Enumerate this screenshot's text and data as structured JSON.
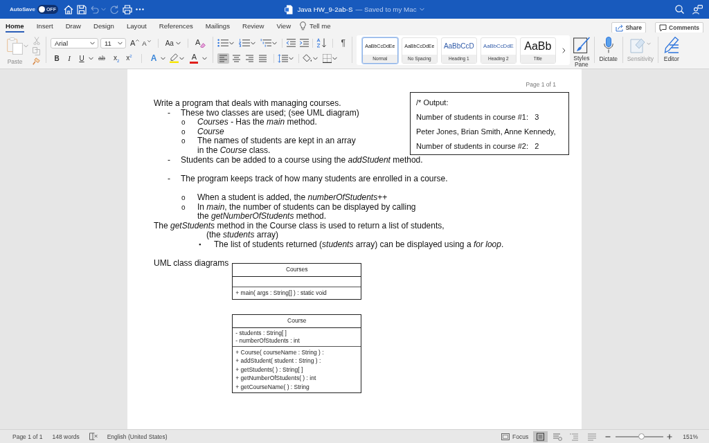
{
  "title_bar": {
    "autosave": {
      "label": "AutoSave",
      "on": false,
      "state_label": "OFF"
    },
    "quick_access": [
      {
        "kind": "home",
        "disabled": false
      },
      {
        "kind": "save",
        "disabled": false
      },
      {
        "kind": "undo",
        "disabled": true
      },
      {
        "kind": "redo",
        "disabled": true
      },
      {
        "kind": "print",
        "disabled": false
      },
      {
        "kind": "more",
        "disabled": false
      }
    ],
    "document_name": "Java HW_9-2ab-S",
    "save_status": "— Saved to my Mac"
  },
  "tabs": [
    {
      "label": "Home",
      "selected": true
    },
    {
      "label": "Insert",
      "selected": false
    },
    {
      "label": "Draw",
      "selected": false
    },
    {
      "label": "Design",
      "selected": false
    },
    {
      "label": "Layout",
      "selected": false
    },
    {
      "label": "References",
      "selected": false
    },
    {
      "label": "Mailings",
      "selected": false
    },
    {
      "label": "Review",
      "selected": false
    },
    {
      "label": "View",
      "selected": false
    }
  ],
  "tell_me": "Tell me",
  "share_button": "Share",
  "comments_button": "Comments",
  "ribbon": {
    "paste": {
      "label": "Paste",
      "disabled": true
    },
    "font_name": "Arial",
    "font_size": "11",
    "font_tools": [
      {
        "kind": "grow",
        "label": "A"
      },
      {
        "kind": "shrink",
        "label": "A"
      },
      {
        "kind": "change_case",
        "label": "Aa"
      },
      {
        "kind": "clear_formatting",
        "label": "A"
      }
    ],
    "format_tools": [
      {
        "kind": "bold",
        "label": "B"
      },
      {
        "kind": "italic",
        "label": "I"
      },
      {
        "kind": "underline",
        "label": "U"
      },
      {
        "kind": "strikethrough",
        "label": "ab"
      },
      {
        "kind": "subscript",
        "label": "x$_{2}$"
      },
      {
        "kind": "superscript",
        "label": "x$^{2}$"
      }
    ],
    "text_effects": "A",
    "font_color": "A",
    "show_marks": "¶",
    "alignment": [
      {
        "kind": "left",
        "selected": true
      },
      {
        "kind": "center",
        "selected": false
      },
      {
        "kind": "right",
        "selected": false
      },
      {
        "kind": "justify",
        "selected": false
      }
    ],
    "styles": [
      {
        "kind": "normal",
        "preview": "AaBbCcDdEe",
        "name": "Normal",
        "selected": true
      },
      {
        "kind": "no_spacing",
        "preview": "AaBbCcDdEe",
        "name": "No Spacing",
        "selected": false
      },
      {
        "kind": "heading1",
        "preview": "AaBbCcD",
        "name": "Heading 1",
        "selected": false
      },
      {
        "kind": "heading2",
        "preview": "AaBbCcDdE",
        "name": "Heading 2",
        "selected": false
      },
      {
        "kind": "title",
        "preview": "AaBb",
        "name": "Title",
        "selected": false
      }
    ],
    "tools": [
      {
        "kind": "styles_pane",
        "label": "Styles Pane",
        "disabled": false
      },
      {
        "kind": "dictate",
        "label": "Dictate",
        "disabled": false
      },
      {
        "kind": "sensitivity",
        "label": "Sensitivity",
        "disabled": true
      },
      {
        "kind": "editor",
        "label": "Editor",
        "disabled": false
      }
    ]
  },
  "document": {
    "page_indicator": "Page 1 of 1",
    "items": [
      {
        "kind": "plain",
        "lines": [
          "Write a program that deals with managing courses."
        ],
        "blank_before": false,
        "children": [
          {
            "kind": "dash",
            "marker": "-",
            "lines": [
              "These two classes are used; (see UML diagram)"
            ],
            "blank_before": false,
            "children": [
              {
                "kind": "circle",
                "marker": "o",
                "lines": [
                  "*Courses -* Has the *main* method."
                ],
                "blank_before": false
              },
              {
                "kind": "circle",
                "marker": "o",
                "lines": [
                  "*Course*"
                ],
                "blank_before": false
              },
              {
                "kind": "circle",
                "marker": "o",
                "lines": [
                  "The names of students are kept in an array",
                  "in the *Course* class."
                ],
                "blank_before": false
              }
            ]
          },
          {
            "kind": "dash",
            "marker": "-",
            "lines": [
              "Students can be added to a course using the *addStudent* method."
            ],
            "blank_before": false
          },
          {
            "kind": "dash",
            "marker": "-",
            "lines": [
              "The program keeps track of how many students are enrolled in a course."
            ],
            "blank_before": true,
            "children": [
              {
                "kind": "circle",
                "marker": "o",
                "lines": [
                  "When a student is added, the *numberOfStudents*++"
                ],
                "blank_before": true
              },
              {
                "kind": "circle",
                "marker": "o",
                "lines": [
                  "In *main*, the number of students can be displayed by calling",
                  "the *getNumberOfStudents* method."
                ],
                "blank_before": false
              }
            ]
          }
        ]
      },
      {
        "kind": "plain",
        "lines": [
          "The *getStudents* method in the Course class is used to return a list of students,",
          "(the *students* array)"
        ],
        "blank_before": false,
        "children": [
          {
            "kind": "square",
            "marker": "▪",
            "lines": [
              "The list of students returned (*students* array) can be displayed using a *for loop*."
            ],
            "blank_before": false
          }
        ]
      }
    ],
    "output_box": [
      "/* Output:",
      "Number of students in course #1:   3",
      "Peter Jones, Brian Smith, Anne Kennedy,",
      "Number of students in course #2:   2"
    ],
    "uml": {
      "label": "UML class diagrams",
      "classes": [
        {
          "name": "Courses",
          "operations": [
            "+ main( args : String[] ) : static void"
          ]
        },
        {
          "name": "Course",
          "attributes": [
            "- students : String[ ]",
            "- numberOfStudents : int"
          ],
          "operations": [
            "+ Course( courseName : String ) :",
            "+ addStudent( student : String ) :",
            "+ getStudents( ) : String[ ]",
            "+ getNumberOfStudents( ) : int",
            "+ getCourseName( ) : String"
          ]
        }
      ]
    }
  },
  "status_bar": {
    "page": "Page 1 of 1",
    "words": "148 words",
    "language": "English (United States)",
    "focus": "Focus",
    "views": [
      {
        "kind": "print_layout",
        "selected": true
      },
      {
        "kind": "web_layout",
        "selected": false
      },
      {
        "kind": "outline",
        "selected": false
      },
      {
        "kind": "draft",
        "selected": false
      }
    ],
    "zoom": {
      "level": 0.54,
      "reading": "151%"
    }
  }
}
